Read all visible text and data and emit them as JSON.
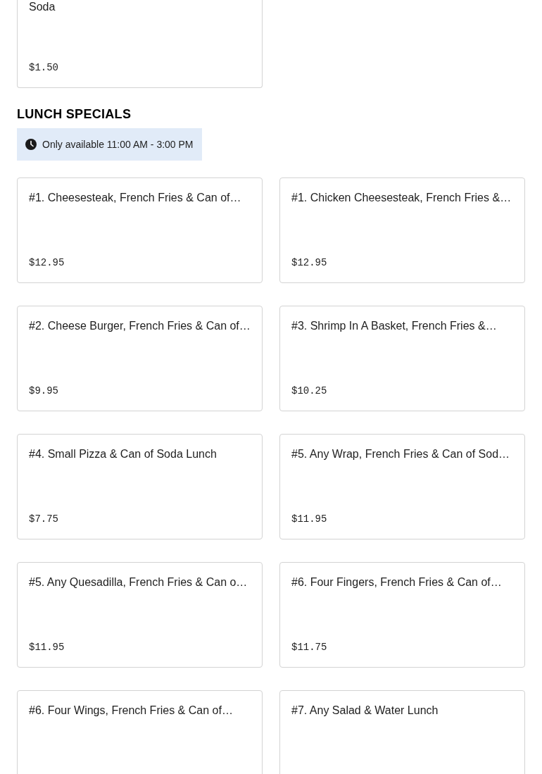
{
  "previous_section": {
    "items": [
      {
        "title": "Soda",
        "price": "$1.50"
      }
    ]
  },
  "lunch_specials": {
    "title": "LUNCH SPECIALS",
    "availability": "Only available 11:00 AM - 3:00 PM",
    "items": [
      {
        "title": "#1. Cheesesteak, French Fries & Can of…",
        "price": "$12.95"
      },
      {
        "title": "#1. Chicken Cheesesteak, French Fries &…",
        "price": "$12.95"
      },
      {
        "title": "#2. Cheese Burger, French Fries & Can of…",
        "price": "$9.95"
      },
      {
        "title": "#3. Shrimp In A Basket, French Fries &…",
        "price": "$10.25"
      },
      {
        "title": "#4. Small Pizza & Can of Soda Lunch",
        "price": "$7.75"
      },
      {
        "title": "#5. Any Wrap, French Fries & Can of Sod…",
        "price": "$11.95"
      },
      {
        "title": "#5. Any Quesadilla, French Fries & Can o…",
        "price": "$11.95"
      },
      {
        "title": "#6. Four Fingers, French Fries & Can of…",
        "price": "$11.75"
      },
      {
        "title": "#6. Four Wings, French Fries & Can of…"
      },
      {
        "title": "#7. Any Salad & Water Lunch"
      }
    ]
  }
}
